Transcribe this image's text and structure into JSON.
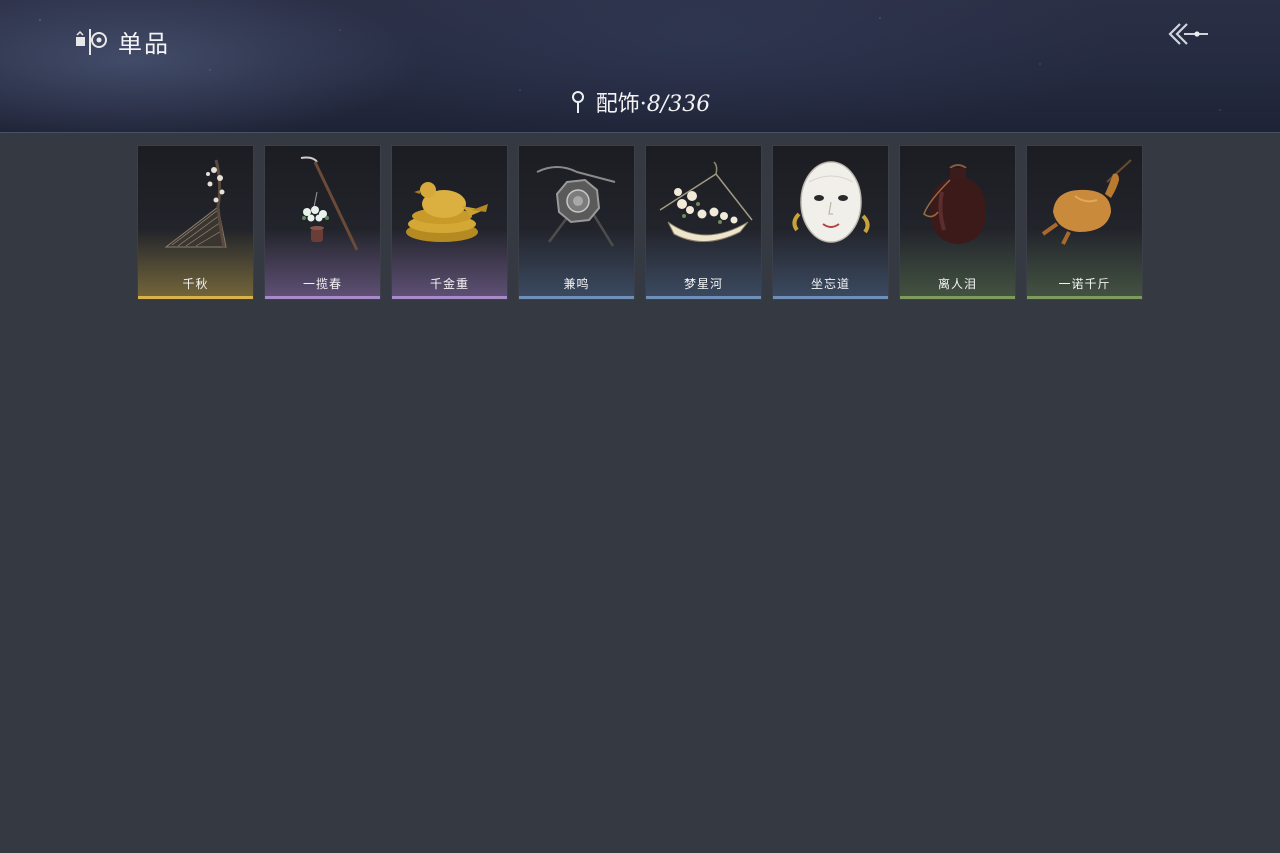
{
  "header": {
    "title": "单品",
    "category_label": "配饰",
    "separator": "·",
    "count": "8/336"
  },
  "items": [
    {
      "name": "千秋",
      "rarity": "gold",
      "icon": "lute-branch-icon"
    },
    {
      "name": "一揽春",
      "rarity": "purple",
      "icon": "flower-staff-icon"
    },
    {
      "name": "千金重",
      "rarity": "purple",
      "icon": "gold-bird-icon"
    },
    {
      "name": "兼鸣",
      "rarity": "blue",
      "icon": "shield-ornament-icon"
    },
    {
      "name": "梦星河",
      "rarity": "blue",
      "icon": "flower-basket-icon"
    },
    {
      "name": "坐忘道",
      "rarity": "blue",
      "icon": "white-mask-icon"
    },
    {
      "name": "离人泪",
      "rarity": "green",
      "icon": "wine-jar-icon"
    },
    {
      "name": "一诺千斤",
      "rarity": "green",
      "icon": "roast-duck-icon"
    }
  ],
  "colors": {
    "gold": "#d8b24a",
    "purple": "#a78bc9",
    "blue": "#6f8fb8",
    "green": "#7e9a5c",
    "background": "#353942"
  }
}
